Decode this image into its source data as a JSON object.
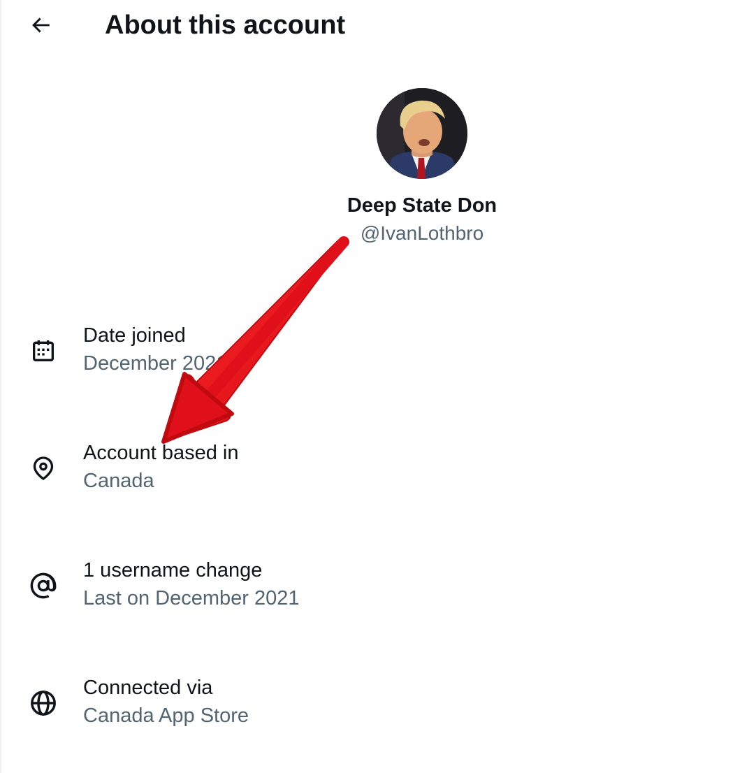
{
  "header": {
    "title": "About this account",
    "back_icon": "arrow-left-icon"
  },
  "profile": {
    "display_name": "Deep State Don",
    "handle": "@IvanLothbro"
  },
  "info": [
    {
      "icon": "calendar-icon",
      "label": "Date joined",
      "value": "December 2021"
    },
    {
      "icon": "location-pin-icon",
      "label": "Account based in",
      "value": "Canada"
    },
    {
      "icon": "at-sign-icon",
      "label": "1 username change",
      "value": "Last on December 2021"
    },
    {
      "icon": "globe-icon",
      "label": "Connected via",
      "value": "Canada App Store"
    }
  ],
  "colors": {
    "primary_text": "#0f1419",
    "secondary_text": "#536471",
    "annotation_arrow": "#e0101a"
  }
}
